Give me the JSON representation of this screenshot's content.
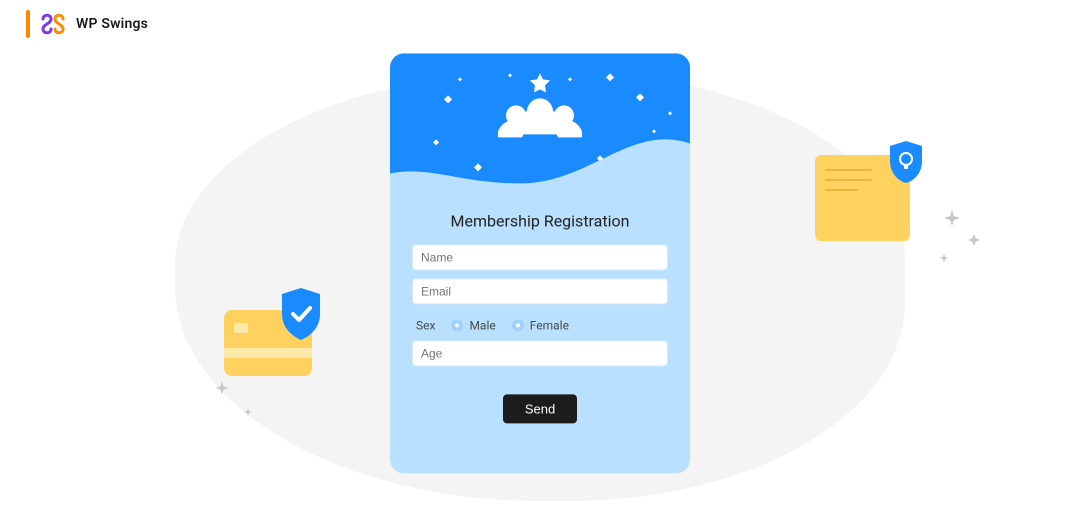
{
  "brand": {
    "name": "WP Swings"
  },
  "form": {
    "title": "Membership Registration",
    "name_placeholder": "Name",
    "email_placeholder": "Email",
    "age_placeholder": "Age",
    "sex_label": "Sex",
    "male_label": "Male",
    "female_label": "Female",
    "send_label": "Send"
  },
  "colors": {
    "accent_blue": "#1a8bff",
    "card_light_blue": "#b9e0ff",
    "yellow": "#ffd25f",
    "orange": "#ff8a00",
    "blob_grey": "#f4f4f5",
    "sparkle_grey": "#c6c6c6"
  }
}
